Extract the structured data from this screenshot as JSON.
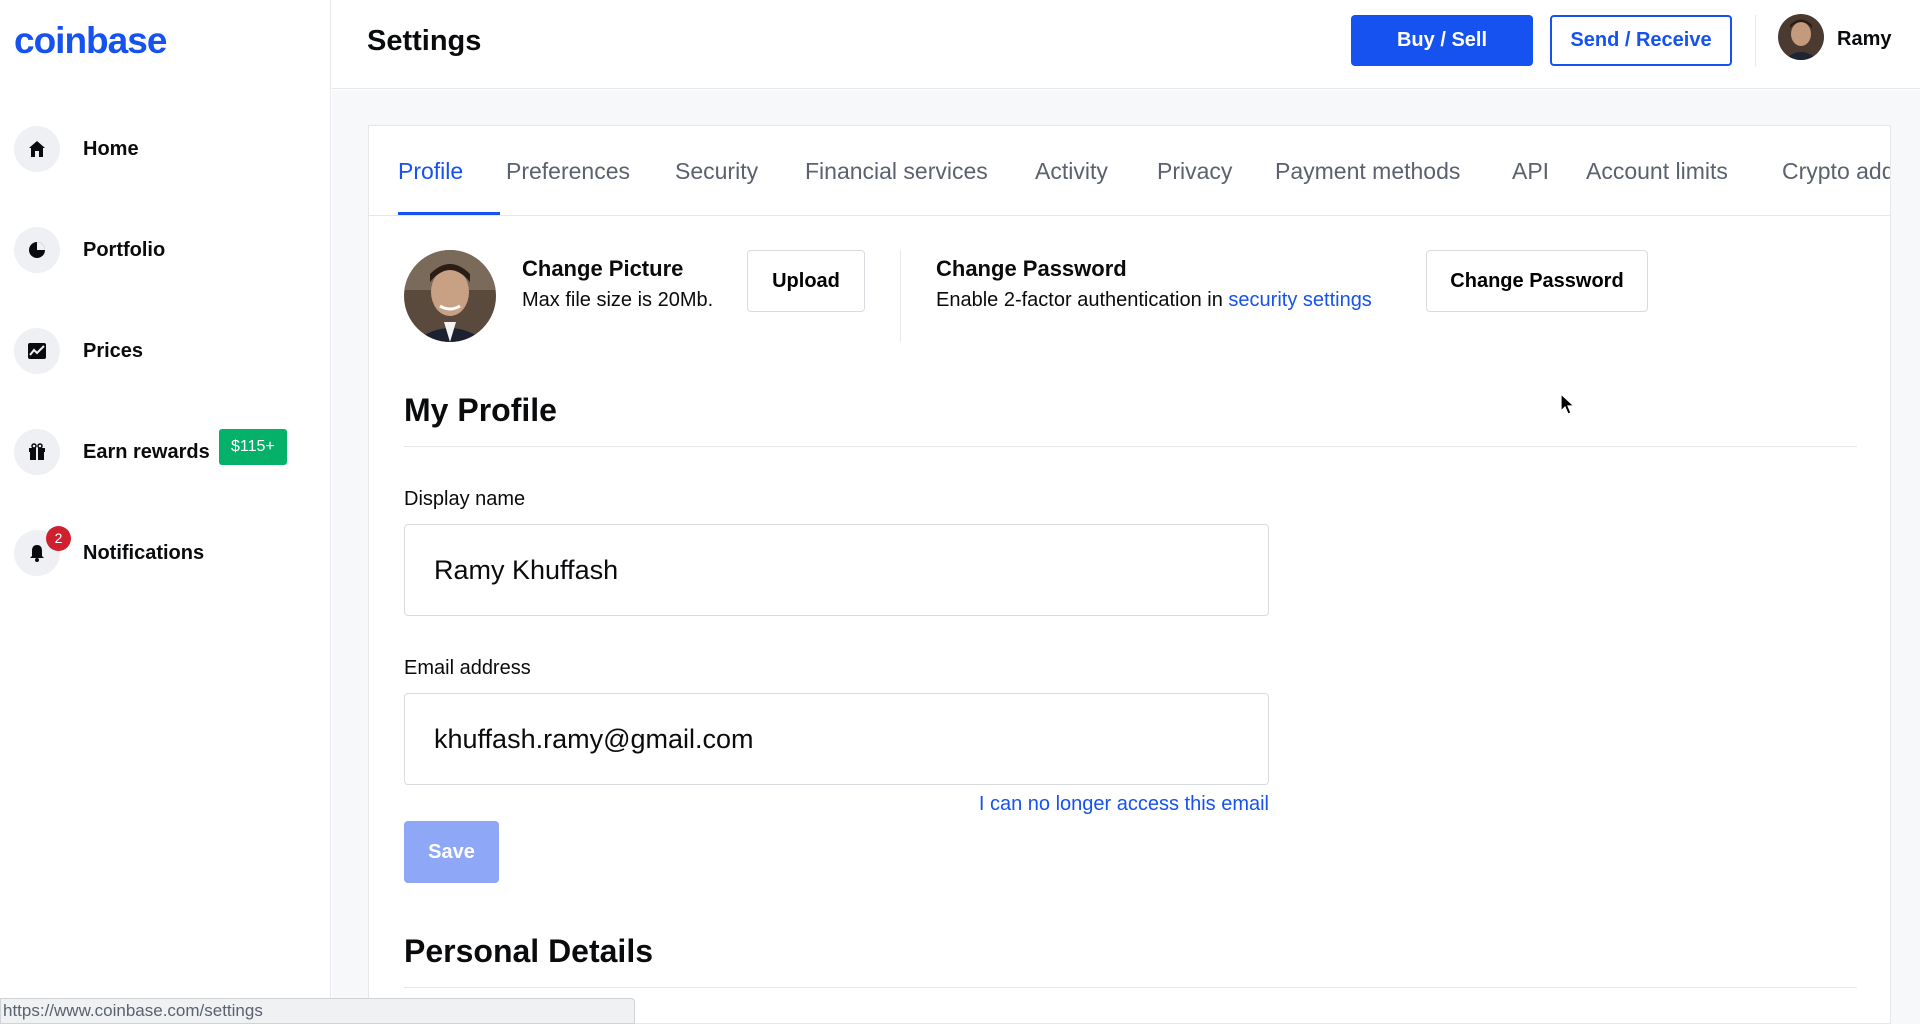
{
  "brand": {
    "logo": "coinbase"
  },
  "sidebar": {
    "items": [
      {
        "label": "Home",
        "icon": "home-icon"
      },
      {
        "label": "Portfolio",
        "icon": "pie-chart-icon"
      },
      {
        "label": "Prices",
        "icon": "chart-icon"
      },
      {
        "label": "Earn rewards",
        "icon": "gift-icon",
        "badge": "$115+"
      },
      {
        "label": "Notifications",
        "icon": "bell-icon",
        "count": "2"
      }
    ]
  },
  "header": {
    "title": "Settings",
    "buy_sell_label": "Buy / Sell",
    "send_receive_label": "Send / Receive",
    "user_name": "Ramy"
  },
  "tabs": [
    {
      "label": "Profile",
      "active": true
    },
    {
      "label": "Preferences"
    },
    {
      "label": "Security"
    },
    {
      "label": "Financial services"
    },
    {
      "label": "Activity"
    },
    {
      "label": "Privacy"
    },
    {
      "label": "Payment methods"
    },
    {
      "label": "API"
    },
    {
      "label": "Account limits"
    },
    {
      "label": "Crypto addre"
    }
  ],
  "picture": {
    "title": "Change Picture",
    "subtitle": "Max file size is 20Mb.",
    "upload_label": "Upload"
  },
  "password": {
    "title": "Change Password",
    "subtitle_prefix": "Enable 2-factor authentication in ",
    "subtitle_link": "security settings",
    "button_label": "Change Password"
  },
  "profile": {
    "section_title": "My Profile",
    "display_name_label": "Display name",
    "display_name_value": "Ramy Khuffash",
    "email_label": "Email address",
    "email_value": "khuffash.ramy@gmail.com",
    "lost_email_link": "I can no longer access this email",
    "save_label": "Save"
  },
  "personal": {
    "section_title": "Personal Details"
  },
  "status_bar": {
    "url": "https://www.coinbase.com/settings"
  },
  "colors": {
    "brand_blue": "#1652f0",
    "reward_green": "#05b169",
    "notif_red": "#cf202f"
  }
}
